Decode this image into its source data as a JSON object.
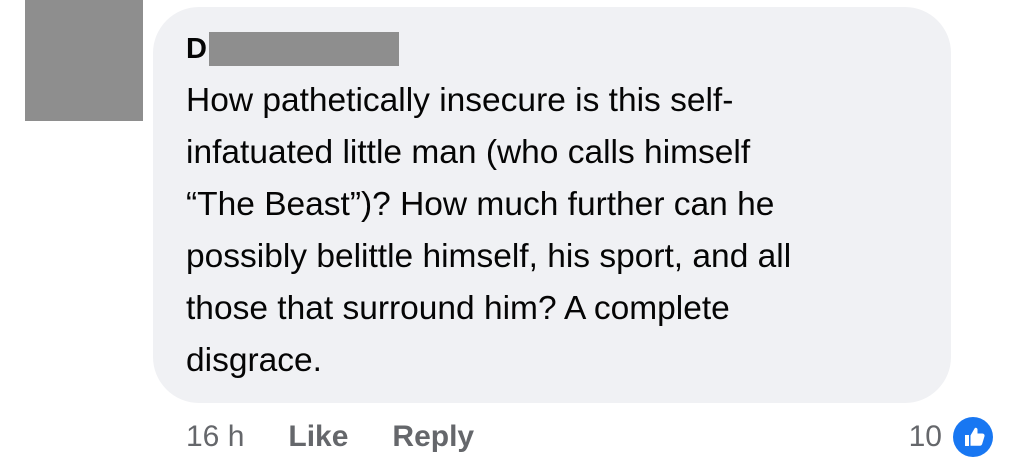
{
  "comment": {
    "author_visible": "D",
    "text": "How pathetically insecure is this self-\ninfatuated little man (who calls himself\n“The Beast”)? How much further can he\npossibly belittle himself, his sport, and all\nthose that surround him? A complete\ndisgrace.",
    "timestamp": "16 h",
    "like_label": "Like",
    "reply_label": "Reply",
    "reaction_count": "10",
    "reaction_icon": "like-thumbs-up-icon"
  },
  "colors": {
    "bubble_background": "#f0f1f4",
    "redaction": "#8e8e8e",
    "secondary_text": "#65676b",
    "like_blue": "#1877f2"
  }
}
